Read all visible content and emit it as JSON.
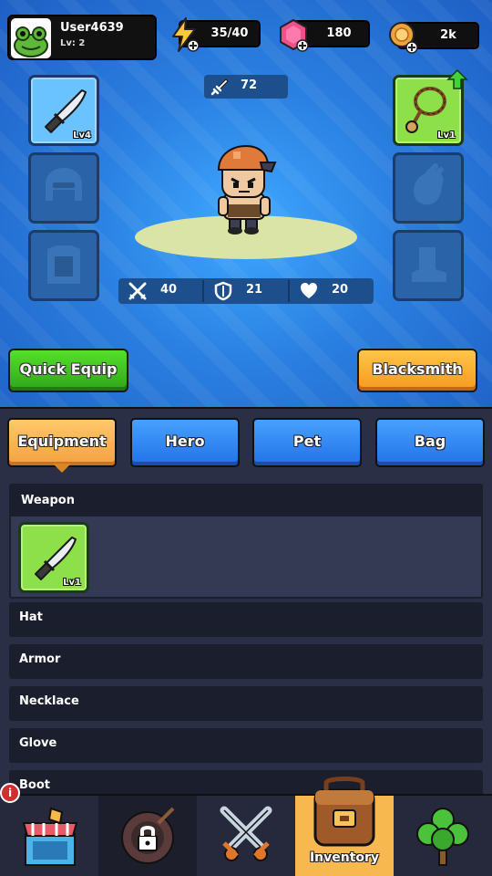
{
  "player": {
    "name": "User4639",
    "level": "Lv: 2"
  },
  "resources": {
    "energy": "35/40",
    "gems": "180",
    "gold": "2k"
  },
  "hero": {
    "power": "72",
    "stats": {
      "attack": "40",
      "defense": "21",
      "health": "20"
    }
  },
  "slots": {
    "weapon_level": "Lv4",
    "necklace_level": "Lv1"
  },
  "buttons": {
    "quick_equip": "Quick Equip",
    "blacksmith": "Blacksmith"
  },
  "tabs": [
    "Equipment",
    "Hero",
    "Pet",
    "Bag"
  ],
  "categories": {
    "weapon": "Weapon",
    "hat": "Hat",
    "armor": "Armor",
    "necklace": "Necklace",
    "glove": "Glove",
    "boot": "Boot"
  },
  "inventory_items": {
    "weapon_item_level": "Lv1"
  },
  "nav": {
    "inventory_label": "Inventory",
    "badge": "i"
  },
  "colors": {
    "rarity_blue": "#6ac2ff",
    "rarity_green": "#8ee04a",
    "active_tab": "#f5a041",
    "tab_blue": "#2272e6"
  }
}
